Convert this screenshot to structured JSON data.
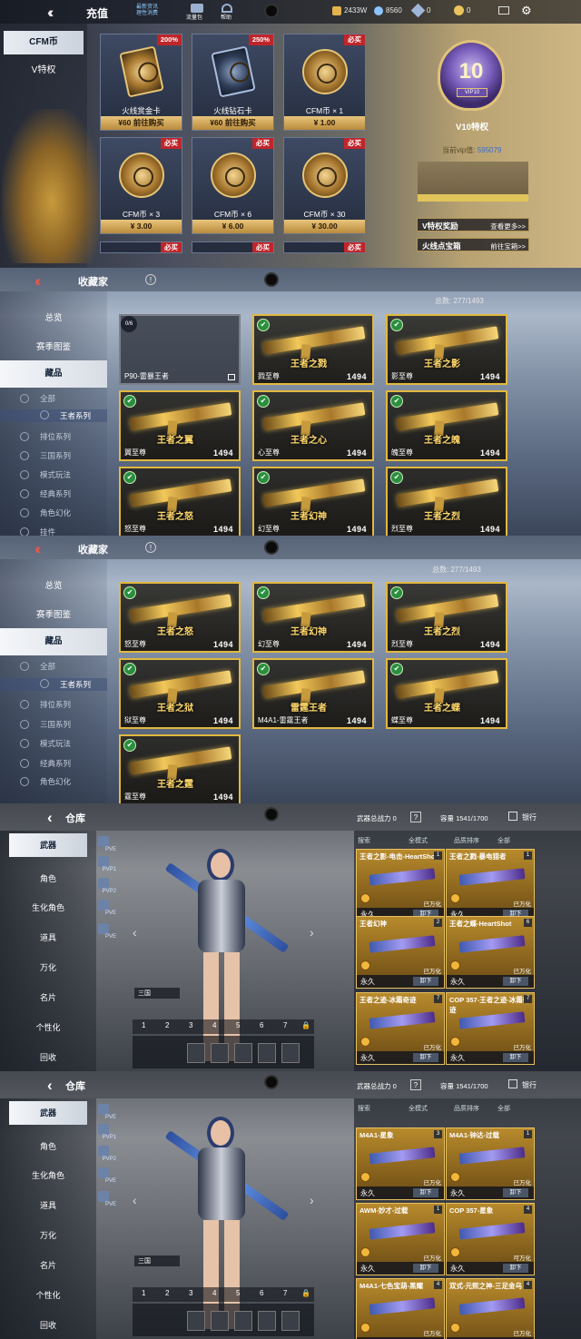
{
  "recharge": {
    "title": "充值",
    "top_links": [
      "最新资讯",
      "理性消费"
    ],
    "top_icons": [
      "流量包",
      "帮助"
    ],
    "currency_a": "2433W",
    "currency_b": "8560",
    "currency_c": "0",
    "currency_d": "0",
    "nav": [
      "CFM币",
      "V特权"
    ],
    "cards": [
      {
        "name": "火线赏金卡",
        "price": "¥60 前往购买",
        "badge": "200%"
      },
      {
        "name": "火线钻石卡",
        "price": "¥60 前往购买",
        "badge": "250%"
      },
      {
        "name": "CFM币 × 1",
        "price": "¥ 1.00",
        "badge": "必买"
      },
      {
        "name": "CFM币 × 3",
        "price": "¥ 3.00",
        "badge": "必买"
      },
      {
        "name": "CFM币 × 6",
        "price": "¥ 6.00",
        "badge": "必买"
      },
      {
        "name": "CFM币 × 30",
        "price": "¥ 30.00",
        "badge": "必买"
      }
    ],
    "row3_badges": [
      "必买",
      "必买",
      "必买"
    ],
    "vip_emblem": "10",
    "vip_ribbon": "VIP10",
    "vip_title": "V10特权",
    "vip_current_label": "当前vip值:",
    "vip_current_value": "595079",
    "link1_label": "V特权奖励",
    "link1_action": "查看更多>>",
    "link2_label": "火线点宝箱",
    "link2_action": "前往宝箱>>"
  },
  "collector": [
    {
      "title": "收藏家",
      "total": "总数: 277/1493",
      "nav": [
        "总览",
        "赛季图鉴",
        "藏品"
      ],
      "subnav": [
        "全部",
        "王者系列",
        "排位系列",
        "三国系列",
        "模式玩法",
        "经典系列",
        "角色幻化",
        "挂件"
      ],
      "items": [
        {
          "name": "P90-雷暴王者",
          "score": "",
          "progress": "0/6",
          "state": "dim"
        },
        {
          "name": "戮至尊",
          "score": "1494",
          "tag": "王者之戮",
          "state": "ok"
        },
        {
          "name": "影至尊",
          "score": "1494",
          "tag": "王者之影",
          "state": "ok"
        },
        {
          "name": "翼至尊",
          "score": "1494",
          "tag": "王者之翼",
          "state": "ok"
        },
        {
          "name": "心至尊",
          "score": "1494",
          "tag": "王者之心",
          "state": "ok"
        },
        {
          "name": "魄至尊",
          "score": "1494",
          "tag": "王者之魄",
          "state": "ok"
        },
        {
          "name": "怒至尊",
          "score": "1494",
          "tag": "王者之怒",
          "state": "ok"
        },
        {
          "name": "幻至尊",
          "score": "1494",
          "tag": "王者幻神",
          "state": "ok"
        },
        {
          "name": "烈至尊",
          "score": "1494",
          "tag": "王者之烈",
          "state": "ok"
        }
      ]
    },
    {
      "title": "收藏家",
      "total": "总数: 277/1493",
      "nav": [
        "总览",
        "赛季图鉴",
        "藏品"
      ],
      "subnav": [
        "全部",
        "王者系列",
        "排位系列",
        "三国系列",
        "模式玩法",
        "经典系列",
        "角色幻化"
      ],
      "items": [
        {
          "name": "怒至尊",
          "score": "1494",
          "tag": "王者之怒",
          "state": "ok"
        },
        {
          "name": "幻至尊",
          "score": "1494",
          "tag": "王者幻神",
          "state": "ok"
        },
        {
          "name": "烈至尊",
          "score": "1494",
          "tag": "王者之烈",
          "state": "ok"
        },
        {
          "name": "狱至尊",
          "score": "1494",
          "tag": "王者之狱",
          "state": "ok"
        },
        {
          "name": "M4A1-雷霆王者",
          "score": "1494",
          "tag": "雷霆王者",
          "state": "ok"
        },
        {
          "name": "蝶至尊",
          "score": "1494",
          "tag": "王者之蝶",
          "state": "ok"
        },
        {
          "name": "霆至尊",
          "score": "1494",
          "tag": "王者之霆",
          "state": "ok"
        }
      ]
    }
  ],
  "warehouse": [
    {
      "title": "仓库",
      "power_label": "武器总战力 0",
      "capacity": "容量 1541/1700",
      "bank": "银行",
      "nav": [
        "武器",
        "角色",
        "生化角色",
        "道具",
        "万化",
        "名片",
        "个性化",
        "回收"
      ],
      "modes": [
        "PVE",
        "PVP1",
        "PVP2",
        "PVE",
        "PVE"
      ],
      "filters": [
        "搜索",
        "全模式",
        "品质排序",
        "全部"
      ],
      "tab_name": "三国",
      "tab_numbers": [
        "1",
        "2",
        "3",
        "4",
        "5",
        "6",
        "7"
      ],
      "items": [
        {
          "name": "王者之影-电击-HeartShot",
          "qty": "1",
          "status": "已万化",
          "perm": "永久",
          "btn": "卸下"
        },
        {
          "name": "王者之戮-暴电猎者",
          "qty": "1",
          "status": "已万化",
          "perm": "永久",
          "btn": "卸下"
        },
        {
          "name": "王者幻神",
          "qty": "2",
          "status": "已万化",
          "perm": "永久",
          "btn": "卸下"
        },
        {
          "name": "王者之蝶-HeartShot",
          "qty": "6",
          "status": "已万化",
          "perm": "永久",
          "btn": "卸下"
        },
        {
          "name": "王者之迹-冰霜奇迹",
          "qty": "7",
          "status": "已万化",
          "perm": "永久",
          "btn": "卸下"
        },
        {
          "name": "COP 357-王者之迹-冰霜奇迹",
          "qty": "7",
          "status": "已万化",
          "perm": "永久",
          "btn": "卸下"
        }
      ]
    },
    {
      "title": "仓库",
      "power_label": "武器总战力 0",
      "capacity": "容量 1541/1700",
      "bank": "银行",
      "nav": [
        "武器",
        "角色",
        "生化角色",
        "道具",
        "万化",
        "名片",
        "个性化",
        "回收"
      ],
      "modes": [
        "PVE",
        "PVP1",
        "PVP2",
        "PVE",
        "PVE"
      ],
      "filters": [
        "搜索",
        "全模式",
        "品质排序",
        "全部"
      ],
      "tab_name": "三国",
      "tab_numbers": [
        "1",
        "2",
        "3",
        "4",
        "5",
        "6",
        "7"
      ],
      "items": [
        {
          "name": "M4A1-星象",
          "qty": "3",
          "status": "已万化",
          "perm": "永久",
          "btn": "卸下"
        },
        {
          "name": "M4A1-钟达-过载",
          "qty": "1",
          "status": "已万化",
          "perm": "永久",
          "btn": "卸下"
        },
        {
          "name": "AWM-妙才-过载",
          "qty": "1",
          "status": "已万化",
          "perm": "永久",
          "btn": "卸下"
        },
        {
          "name": "COP 357-星象",
          "qty": "4",
          "status": "可万化",
          "perm": "永久",
          "btn": "卸下"
        },
        {
          "name": "M4A1-七色宝葫-黑耀",
          "qty": "4",
          "status": "已万化",
          "perm": "永久",
          "btn": "卸下"
        },
        {
          "name": "双式-元熙之神-三足金乌",
          "qty": "4",
          "status": "已万化",
          "perm": "永久",
          "btn": "卸下"
        }
      ]
    }
  ]
}
